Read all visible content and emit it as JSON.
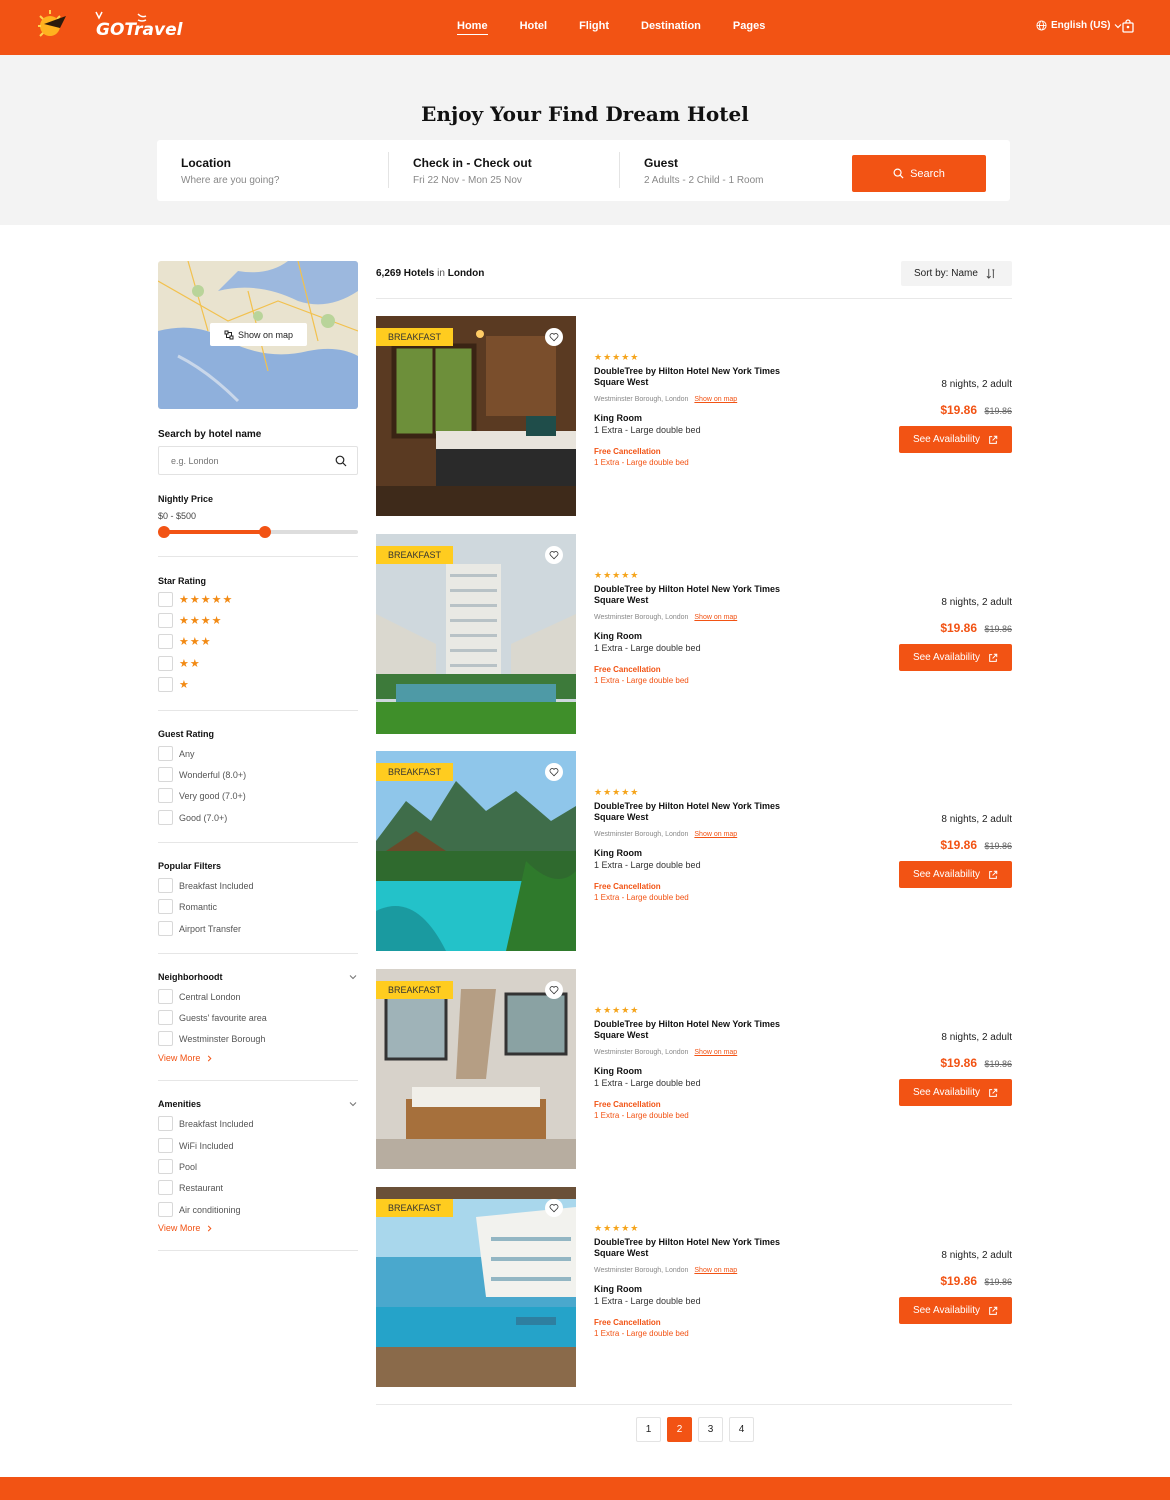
{
  "brand": {
    "logo_text": "GOTravel",
    "accent": "#f25314",
    "badge_color": "#ffcc1f"
  },
  "nav": {
    "items": [
      "Home",
      "Hotel",
      "Flight",
      "Destination",
      "Pages"
    ],
    "active": "Home"
  },
  "header": {
    "language": "English (US)",
    "language_icon": "globe-icon",
    "cart_icon": "bag-icon"
  },
  "hero": {
    "title": "Enjoy Your Find Dream Hotel",
    "location_label": "Location",
    "location_placeholder": "Where are you going?",
    "dates_label": "Check in - Check out",
    "dates_value": "Fri 22 Nov - Mon 25 Nov",
    "guest_label": "Guest",
    "guest_value": "2 Adults - 2 Child - 1 Room",
    "search_label": "Search"
  },
  "sidebar": {
    "map_button": "Show on map",
    "hotel_search_title": "Search by hotel name",
    "hotel_search_placeholder": "e.g. London",
    "price_title": "Nightly Price",
    "price_range": "$0 - $500",
    "price_slider": {
      "min": 0,
      "max": 500,
      "low_fraction": 0.0,
      "high_fraction": 0.52
    },
    "star_title": "Star Rating",
    "star_options": [
      "★★★★★",
      "★★★★",
      "★★★",
      "★★",
      "★"
    ],
    "guest_rating_title": "Guest Rating",
    "guest_rating_options": [
      "Any",
      "Wonderful (8.0+)",
      "Very good (7.0+)",
      "Good (7.0+)"
    ],
    "popular_title": "Popular Filters",
    "popular_options": [
      "Breakfast Included",
      "Romantic",
      "Airport Transfer"
    ],
    "neighborhood_title": "Neighborhoodt",
    "neighborhood_options": [
      "Central London",
      "Guests' favourite area",
      "Westminster Borough"
    ],
    "amenities_title": "Amenities",
    "amenities_options": [
      "Breakfast Included",
      "WiFi Included",
      "Pool",
      "Restaurant",
      "Air conditioning"
    ],
    "view_more": "View More"
  },
  "results": {
    "count": "6,269 Hotels",
    "in": "in",
    "city": "London",
    "sort_label": "Sort by: Name"
  },
  "hotels": [
    {
      "badge": "BREAKFAST",
      "stars": "★★★★★",
      "name": "DoubleTree by Hilton Hotel New York Times Square West",
      "address": "Westminster Borough, London",
      "map_link": "Show on map",
      "room": "King Room",
      "bed": "1 Extra - Large double bed",
      "cancel": "Free Cancellation",
      "extra": "1 Extra - Large double bed",
      "nights": "8 nights, 2 adult",
      "price": "$19.86",
      "old_price": "$19.86",
      "button": "See Availability",
      "scene": "bedroom"
    },
    {
      "badge": "BREAKFAST",
      "stars": "★★★★★",
      "name": "DoubleTree by Hilton Hotel New York Times Square West",
      "address": "Westminster Borough, London",
      "map_link": "Show on map",
      "room": "King Room",
      "bed": "1 Extra - Large double bed",
      "cancel": "Free Cancellation",
      "extra": "1 Extra - Large double bed",
      "nights": "8 nights, 2 adult",
      "price": "$19.86",
      "old_price": "$19.86",
      "button": "See Availability",
      "scene": "tower"
    },
    {
      "badge": "BREAKFAST",
      "stars": "★★★★★",
      "name": "DoubleTree by Hilton Hotel New York Times Square West",
      "address": "Westminster Borough, London",
      "map_link": "Show on map",
      "room": "King Room",
      "bed": "1 Extra - Large double bed",
      "cancel": "Free Cancellation",
      "extra": "1 Extra - Large double bed",
      "nights": "8 nights, 2 adult",
      "price": "$19.86",
      "old_price": "$19.86",
      "button": "See Availability",
      "scene": "pool"
    },
    {
      "badge": "BREAKFAST",
      "stars": "★★★★★",
      "name": "DoubleTree by Hilton Hotel New York Times Square West",
      "address": "Westminster Borough, London",
      "map_link": "Show on map",
      "room": "King Room",
      "bed": "1 Extra - Large double bed",
      "cancel": "Free Cancellation",
      "extra": "1 Extra - Large double bed",
      "nights": "8 nights, 2 adult",
      "price": "$19.86",
      "old_price": "$19.86",
      "button": "See Availability",
      "scene": "loft"
    },
    {
      "badge": "BREAKFAST",
      "stars": "★★★★★",
      "name": "DoubleTree by Hilton Hotel New York Times Square West",
      "address": "Westminster Borough, London",
      "map_link": "Show on map",
      "room": "King Room",
      "bed": "1 Extra - Large double bed",
      "cancel": "Free Cancellation",
      "extra": "1 Extra - Large double bed",
      "nights": "8 nights, 2 adult",
      "price": "$19.86",
      "old_price": "$19.86",
      "button": "See Availability",
      "scene": "sea"
    }
  ],
  "pagination": {
    "pages": [
      "1",
      "2",
      "3",
      "4"
    ],
    "active": "2"
  }
}
